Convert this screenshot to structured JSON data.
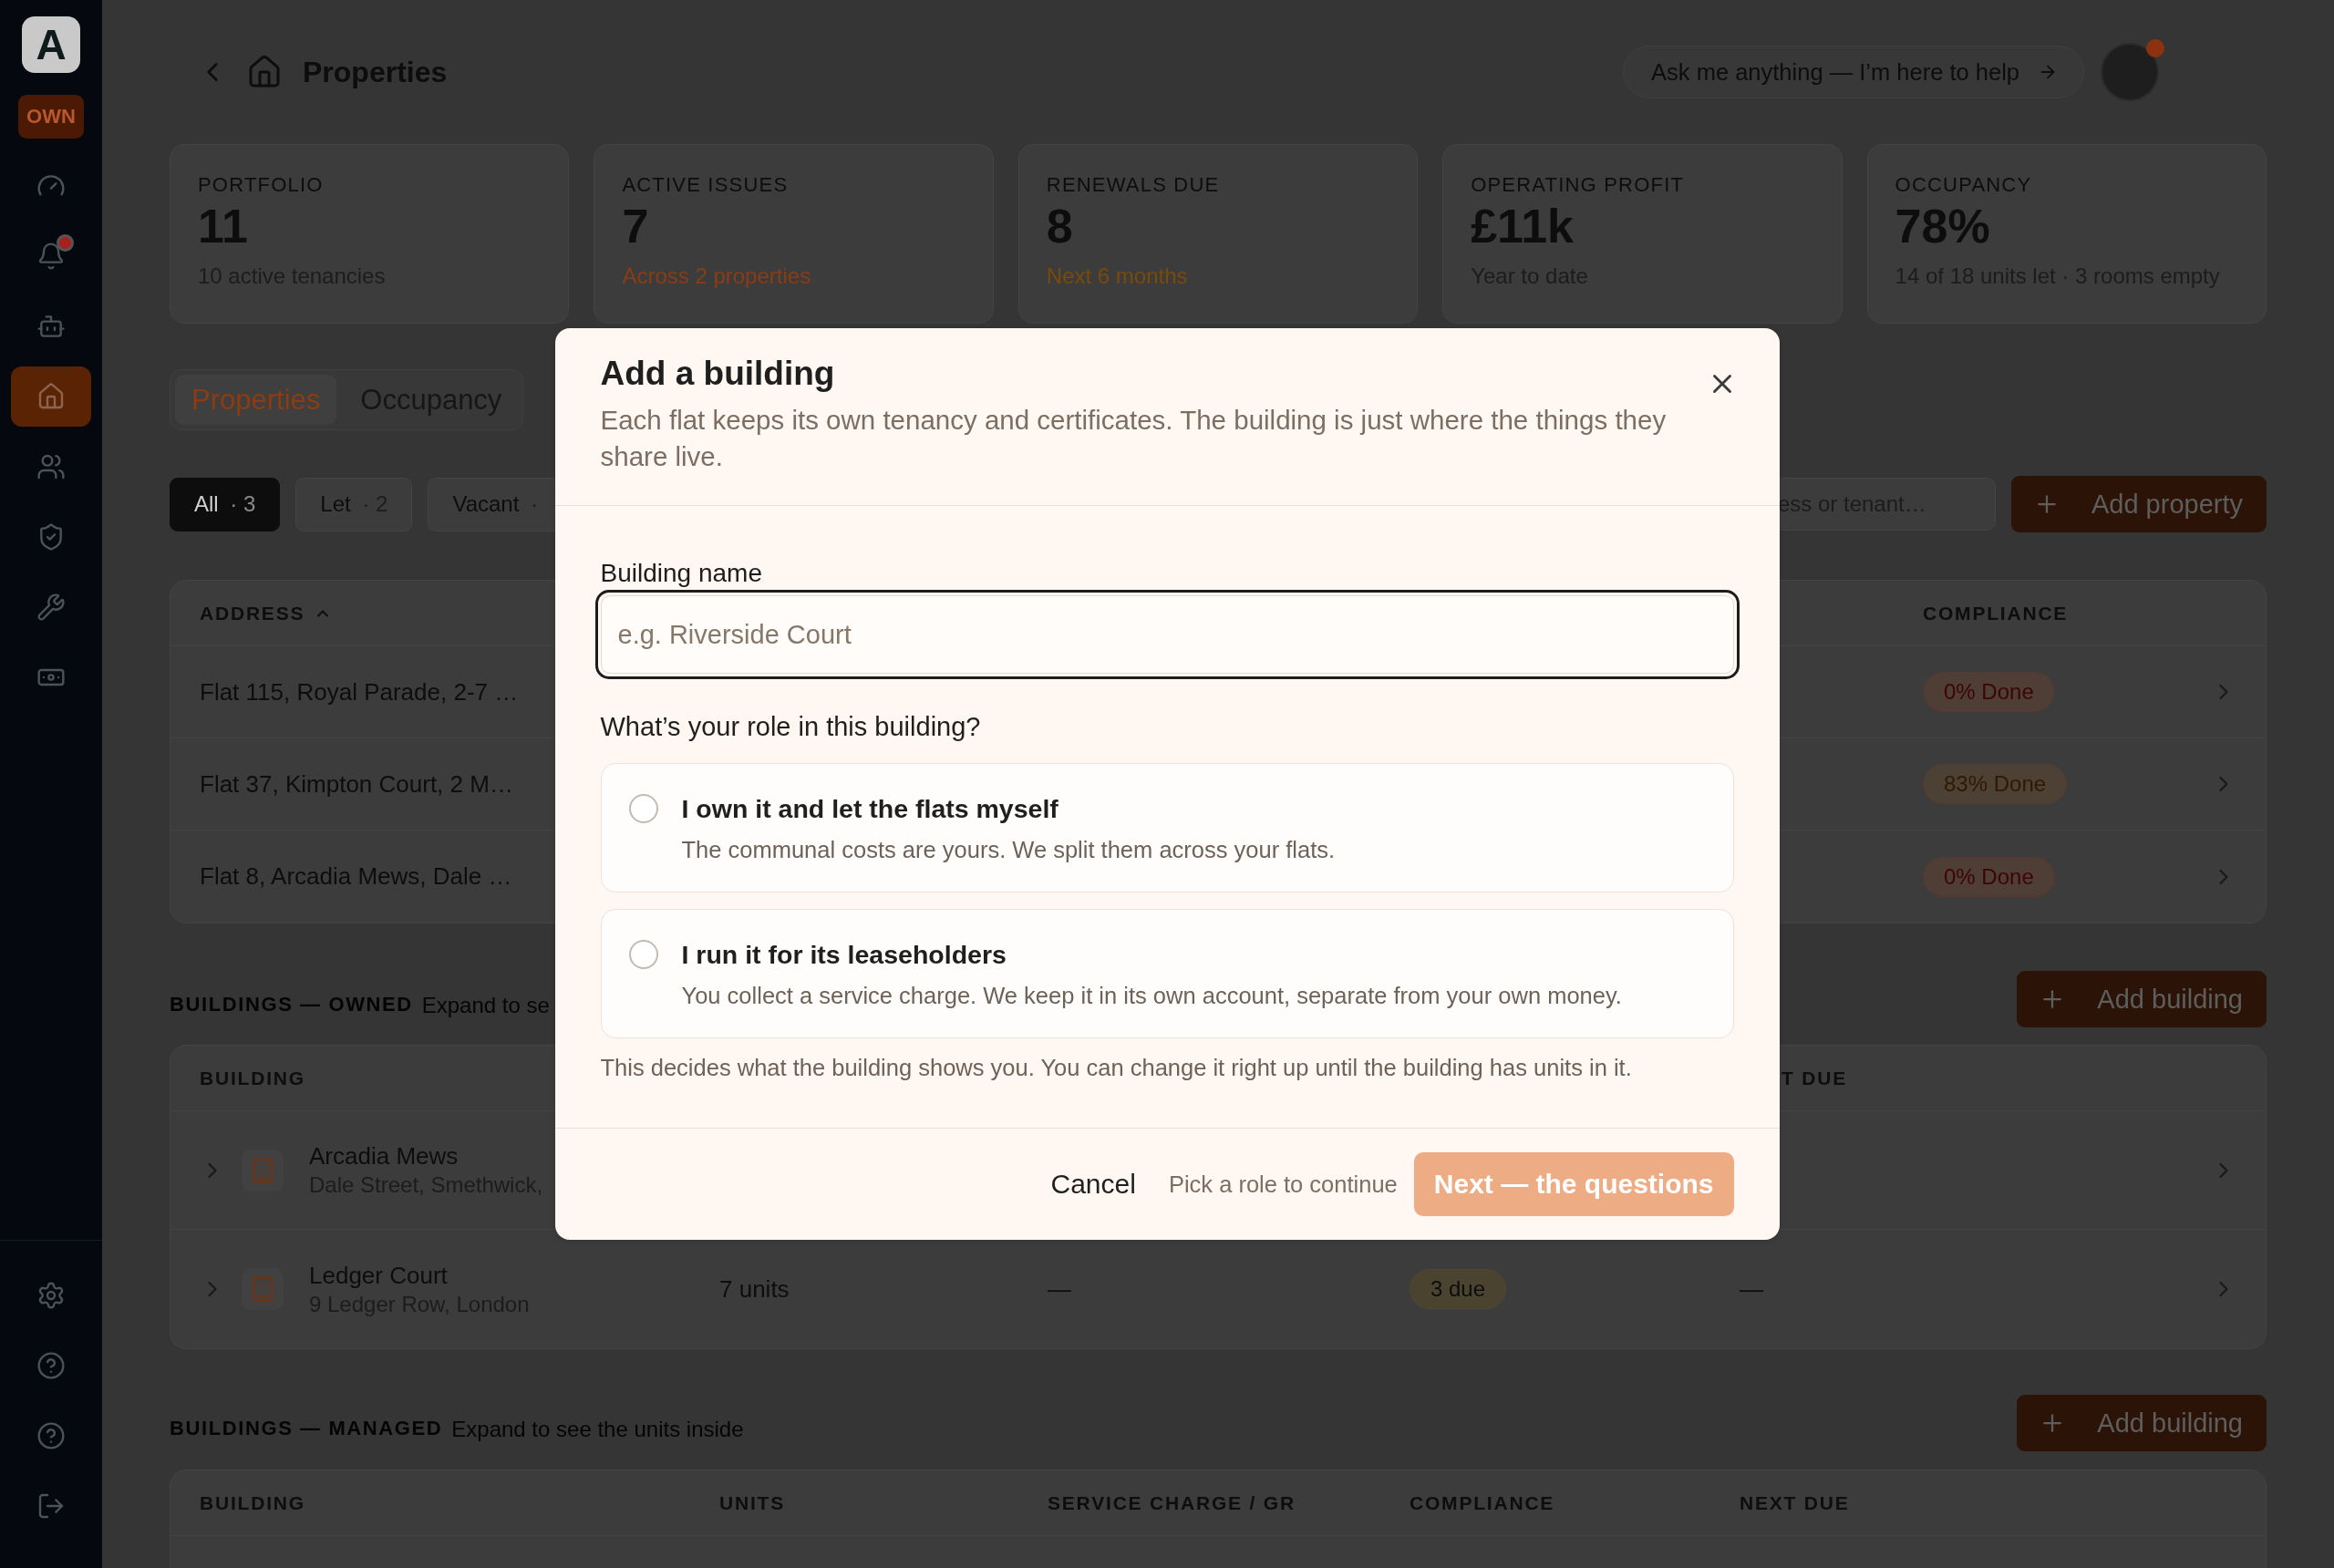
{
  "sidebar": {
    "logo": "A",
    "mode_badge": "OWN",
    "items": [
      {
        "selected": false,
        "badge": false
      },
      {
        "selected": false,
        "badge": true
      },
      {
        "selected": false,
        "badge": false
      },
      {
        "selected": true,
        "badge": false
      },
      {
        "selected": false,
        "badge": false
      },
      {
        "selected": false,
        "badge": false
      },
      {
        "selected": false,
        "badge": false
      },
      {
        "selected": false,
        "badge": false
      }
    ]
  },
  "header": {
    "title": "Properties",
    "assistant_prompt": "Ask me anything — I’m here to help",
    "avatar": {
      "notification": true
    }
  },
  "stats": [
    {
      "label": "PORTFOLIO",
      "value": "11",
      "note": "10 active tenancies",
      "color": "#1c1c1c"
    },
    {
      "label": "ACTIVE ISSUES",
      "value": "7",
      "note": "Across 2 properties",
      "color": "#8c3c12"
    },
    {
      "label": "RENEWALS DUE",
      "value": "8",
      "note": "Next 6 months",
      "color": "#7a4a0a"
    },
    {
      "label": "OPERATING PROFIT",
      "value": "£11k",
      "note": "Year to date",
      "color": "#1c1c1c"
    },
    {
      "label": "OCCUPANCY",
      "value": "78%",
      "note": "14 of 18 units let · 3 rooms empty",
      "color": "#1c1c1c"
    }
  ],
  "view_tabs": [
    {
      "label": "Properties",
      "selected": true
    },
    {
      "label": "Occupancy",
      "selected": false
    }
  ],
  "filters": [
    {
      "label": "All",
      "count": "· 3",
      "selected": true
    },
    {
      "label": "Let",
      "count": "· 2",
      "selected": false
    },
    {
      "label": "Vacant",
      "count": "·",
      "selected": false
    }
  ],
  "search": {
    "placeholder": "ess or tenant…"
  },
  "add_property_button": "Add property",
  "properties_table": {
    "columns": {
      "address": {
        "label": "ADDRESS",
        "sorted": true
      },
      "compliance": "COMPLIANCE"
    },
    "rows": [
      {
        "address": "Flat 115, Royal Parade, 2-7 …",
        "compliance": "0% Done",
        "color": "#3c0505"
      },
      {
        "address": "Flat 37, Kimpton Court, 2 M…",
        "compliance": "83% Done",
        "color": "#2e1a00"
      },
      {
        "address": "Flat 8, Arcadia Mews, Dale …",
        "compliance": "0% Done",
        "color": "#3c0505"
      }
    ]
  },
  "owned_buildings": {
    "title": "BUILDINGS — OWNED",
    "hint": "Expand to se",
    "add_button": "Add building",
    "columns": {
      "column_1": "BUILDING",
      "column_5": "T DUE"
    },
    "rows": [
      {
        "name": "Arcadia Mews",
        "address": "Dale Street, Smethwick,",
        "expanded": false
      },
      {
        "name": "Ledger Court",
        "address": "9 Ledger Row, London",
        "units": "7 units",
        "service_charge": "—",
        "compliance": "3 due",
        "next_due": "—",
        "expanded": false
      }
    ]
  },
  "managed_buildings": {
    "title": "BUILDINGS — MANAGED",
    "hint": "Expand to see the units inside",
    "add_button": "Add building",
    "columns": [
      "BUILDING",
      "UNITS",
      "SERVICE CHARGE / GR",
      "COMPLIANCE",
      "NEXT DUE"
    ]
  },
  "modal": {
    "title": "Add a building",
    "description": "Each flat keeps its own tenancy and certificates. The building is just where the things they share live.",
    "name_field": {
      "label": "Building name",
      "placeholder": "e.g. Riverside Court",
      "focused": true
    },
    "role_question": "What’s your role in this building?",
    "role_options": [
      {
        "title": "I own it and let the flats myself",
        "description": "The communal costs are yours. We split them across your flats.",
        "selected": false
      },
      {
        "title": "I run it for its leaseholders",
        "description": "You collect a service charge. We keep it in its own account, separate from your own money.",
        "selected": false
      }
    ],
    "role_hint": "This decides what the building shows you. You can change it right up until the building has units in it.",
    "cancel_button": "Cancel",
    "footer_hint": "Pick a role to continue",
    "next_button": {
      "label": "Next — the questions",
      "disabled": true
    }
  }
}
